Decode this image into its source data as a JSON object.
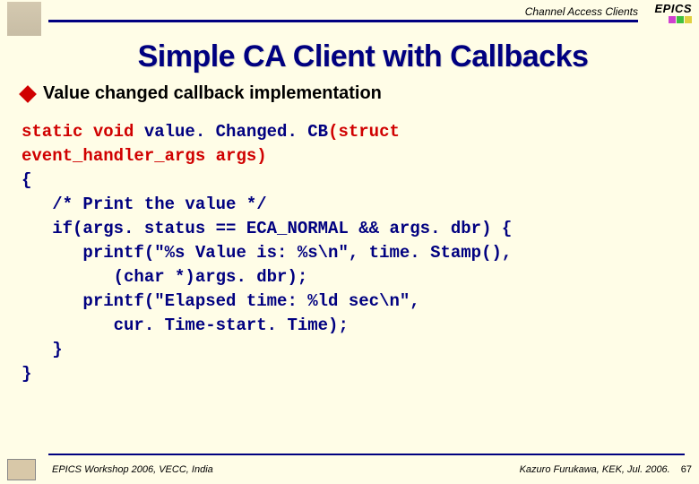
{
  "header": {
    "breadcrumb": "Channel Access Clients",
    "logo_text": "EPICS"
  },
  "title": "Simple CA Client with Callbacks",
  "bullet": "Value changed callback implementation",
  "code": {
    "l1a": "static void",
    "l1b": " value. Changed. CB",
    "l1c": "(struct",
    "l2a": "event_handler_args args)",
    "l3": "{",
    "l4": "   /* Print the value */",
    "l5": "   if(args. status == ECA_NORMAL && args. dbr) {",
    "l6": "      printf(\"%s Value is: %s\\n\", time. Stamp(),",
    "l7": "         (char *)args. dbr);",
    "l8": "      printf(\"Elapsed time: %ld sec\\n\",",
    "l9": "         cur. Time-start. Time);",
    "l10": "   }",
    "l11": "}"
  },
  "footer": {
    "left": "EPICS Workshop 2006, VECC, India",
    "right": "Kazuro Furukawa, KEK, Jul. 2006.",
    "page": "67"
  }
}
